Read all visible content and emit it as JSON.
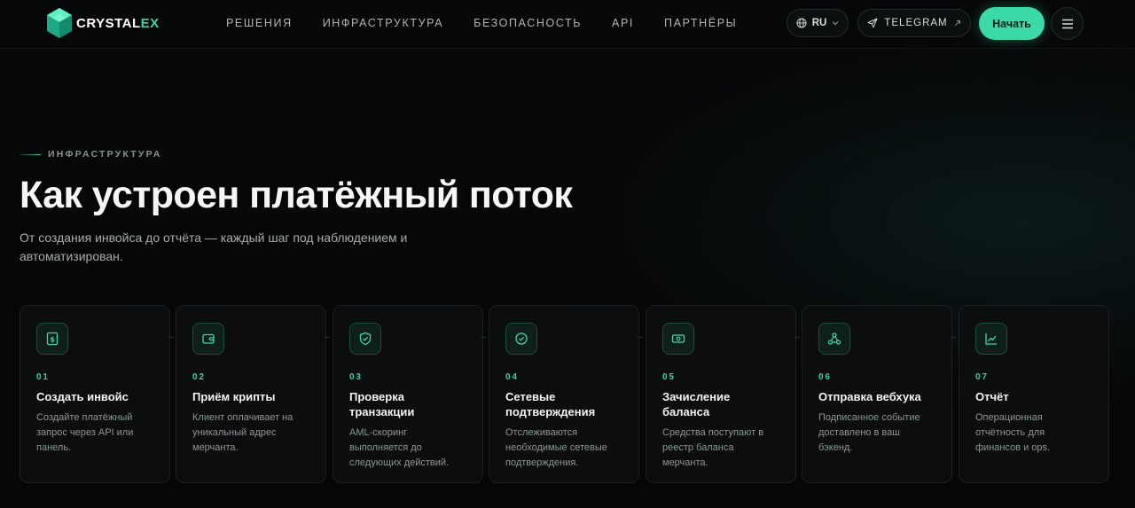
{
  "brand": {
    "name_a": "CRYSTAL",
    "name_b": "EX",
    "accent": "#34d5a4"
  },
  "nav": {
    "items": [
      {
        "label": "РЕШЕНИЯ"
      },
      {
        "label": "ИНФРАСТРУКТУРА"
      },
      {
        "label": "БЕЗОПАСНОСТЬ"
      },
      {
        "label": "API"
      },
      {
        "label": "ПАРТНЁРЫ"
      }
    ],
    "lang": "RU",
    "lang_icon": "globe-icon",
    "telegram": "TELEGRAM",
    "telegram_icon": "send-icon",
    "start": "Начать",
    "menu_icon": "hamburger-icon"
  },
  "section": {
    "eyebrow": "ИНФРАСТРУКТУРА",
    "title": "Как устроен платёжный поток",
    "subtitle": "От создания инвойса до отчёта — каждый шаг под наблюдением и автоматизирован."
  },
  "steps": [
    {
      "num": "01",
      "title": "Создать инвойс",
      "desc": "Создайте платёжный запрос через API или панель.",
      "icon": "invoice-icon"
    },
    {
      "num": "02",
      "title": "Приём крипты",
      "desc": "Клиент оплачивает на уникальный адрес мерчанта.",
      "icon": "wallet-icon"
    },
    {
      "num": "03",
      "title": "Проверка транзакции",
      "desc": "AML-скоринг выполняется до следующих действий.",
      "icon": "shield-icon"
    },
    {
      "num": "04",
      "title": "Сетевые подтверждения",
      "desc": "Отслеживаются необходимые сетевые подтверждения.",
      "icon": "check-circle-icon"
    },
    {
      "num": "05",
      "title": "Зачисление баланса",
      "desc": "Средства поступают в реестр баланса мерчанта.",
      "icon": "banknote-icon"
    },
    {
      "num": "06",
      "title": "Отправка вебхука",
      "desc": "Подписанное событие доставлено в ваш бэкенд.",
      "icon": "webhook-icon"
    },
    {
      "num": "07",
      "title": "Отчёт",
      "desc": "Операционная отчётность для финансов и ops.",
      "icon": "chart-icon"
    }
  ]
}
